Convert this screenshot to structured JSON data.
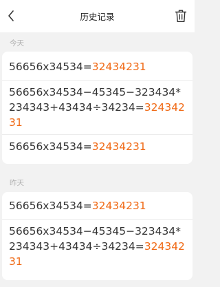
{
  "nav": {
    "title": "历史记录"
  },
  "sections": [
    {
      "label": "今天",
      "entries": [
        {
          "expr": "56656x34534=",
          "result": "32434231"
        },
        {
          "expr": "56656x34534−45345−323434*234343+43434÷34234=",
          "result": "32434231"
        },
        {
          "expr": "56656x34534=",
          "result": "32434231"
        }
      ]
    },
    {
      "label": "昨天",
      "entries": [
        {
          "expr": "56656x34534=",
          "result": "32434231"
        },
        {
          "expr": "56656x34534−45345−323434*234343+43434÷34234=",
          "result": "32434231"
        }
      ]
    }
  ],
  "colors": {
    "result": "#f06a16",
    "label": "#b0b0b0",
    "background": "#f2f2f2"
  },
  "icons": {
    "back": "chevron-left-icon",
    "delete": "trash-icon"
  }
}
